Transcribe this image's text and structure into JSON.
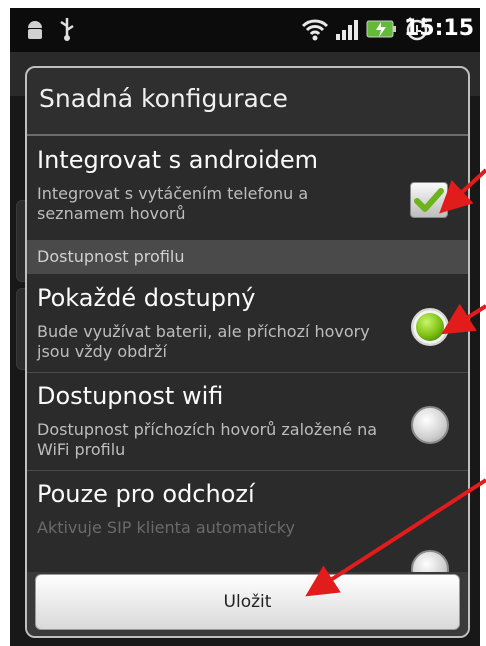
{
  "status_bar": {
    "time": "15:15"
  },
  "dialog": {
    "title": "Snadná konfigurace",
    "rows": [
      {
        "title": "Integrovat s androidem",
        "subtitle": "Integrovat s vytáčením telefonu a seznamem hovorů",
        "control": "checkbox",
        "checked": true
      },
      {
        "section": "Dostupnost profilu"
      },
      {
        "title": "Pokaždé dostupný",
        "subtitle": "Bude využívat baterii, ale příchozí hovory jsou vždy obdrží",
        "control": "radio",
        "checked": true
      },
      {
        "title": "Dostupnost wifi",
        "subtitle": "Dostupnost příchozích hovorů založené na WiFi profilu",
        "control": "radio",
        "checked": false
      },
      {
        "title": "Pouze pro odchozí",
        "subtitle": "Aktivuje SIP klienta automaticky",
        "control": "radio",
        "checked": false
      }
    ],
    "save_label": "Uložit"
  },
  "annotation_color": "#e21b1b",
  "accent_green": "#7fc214"
}
